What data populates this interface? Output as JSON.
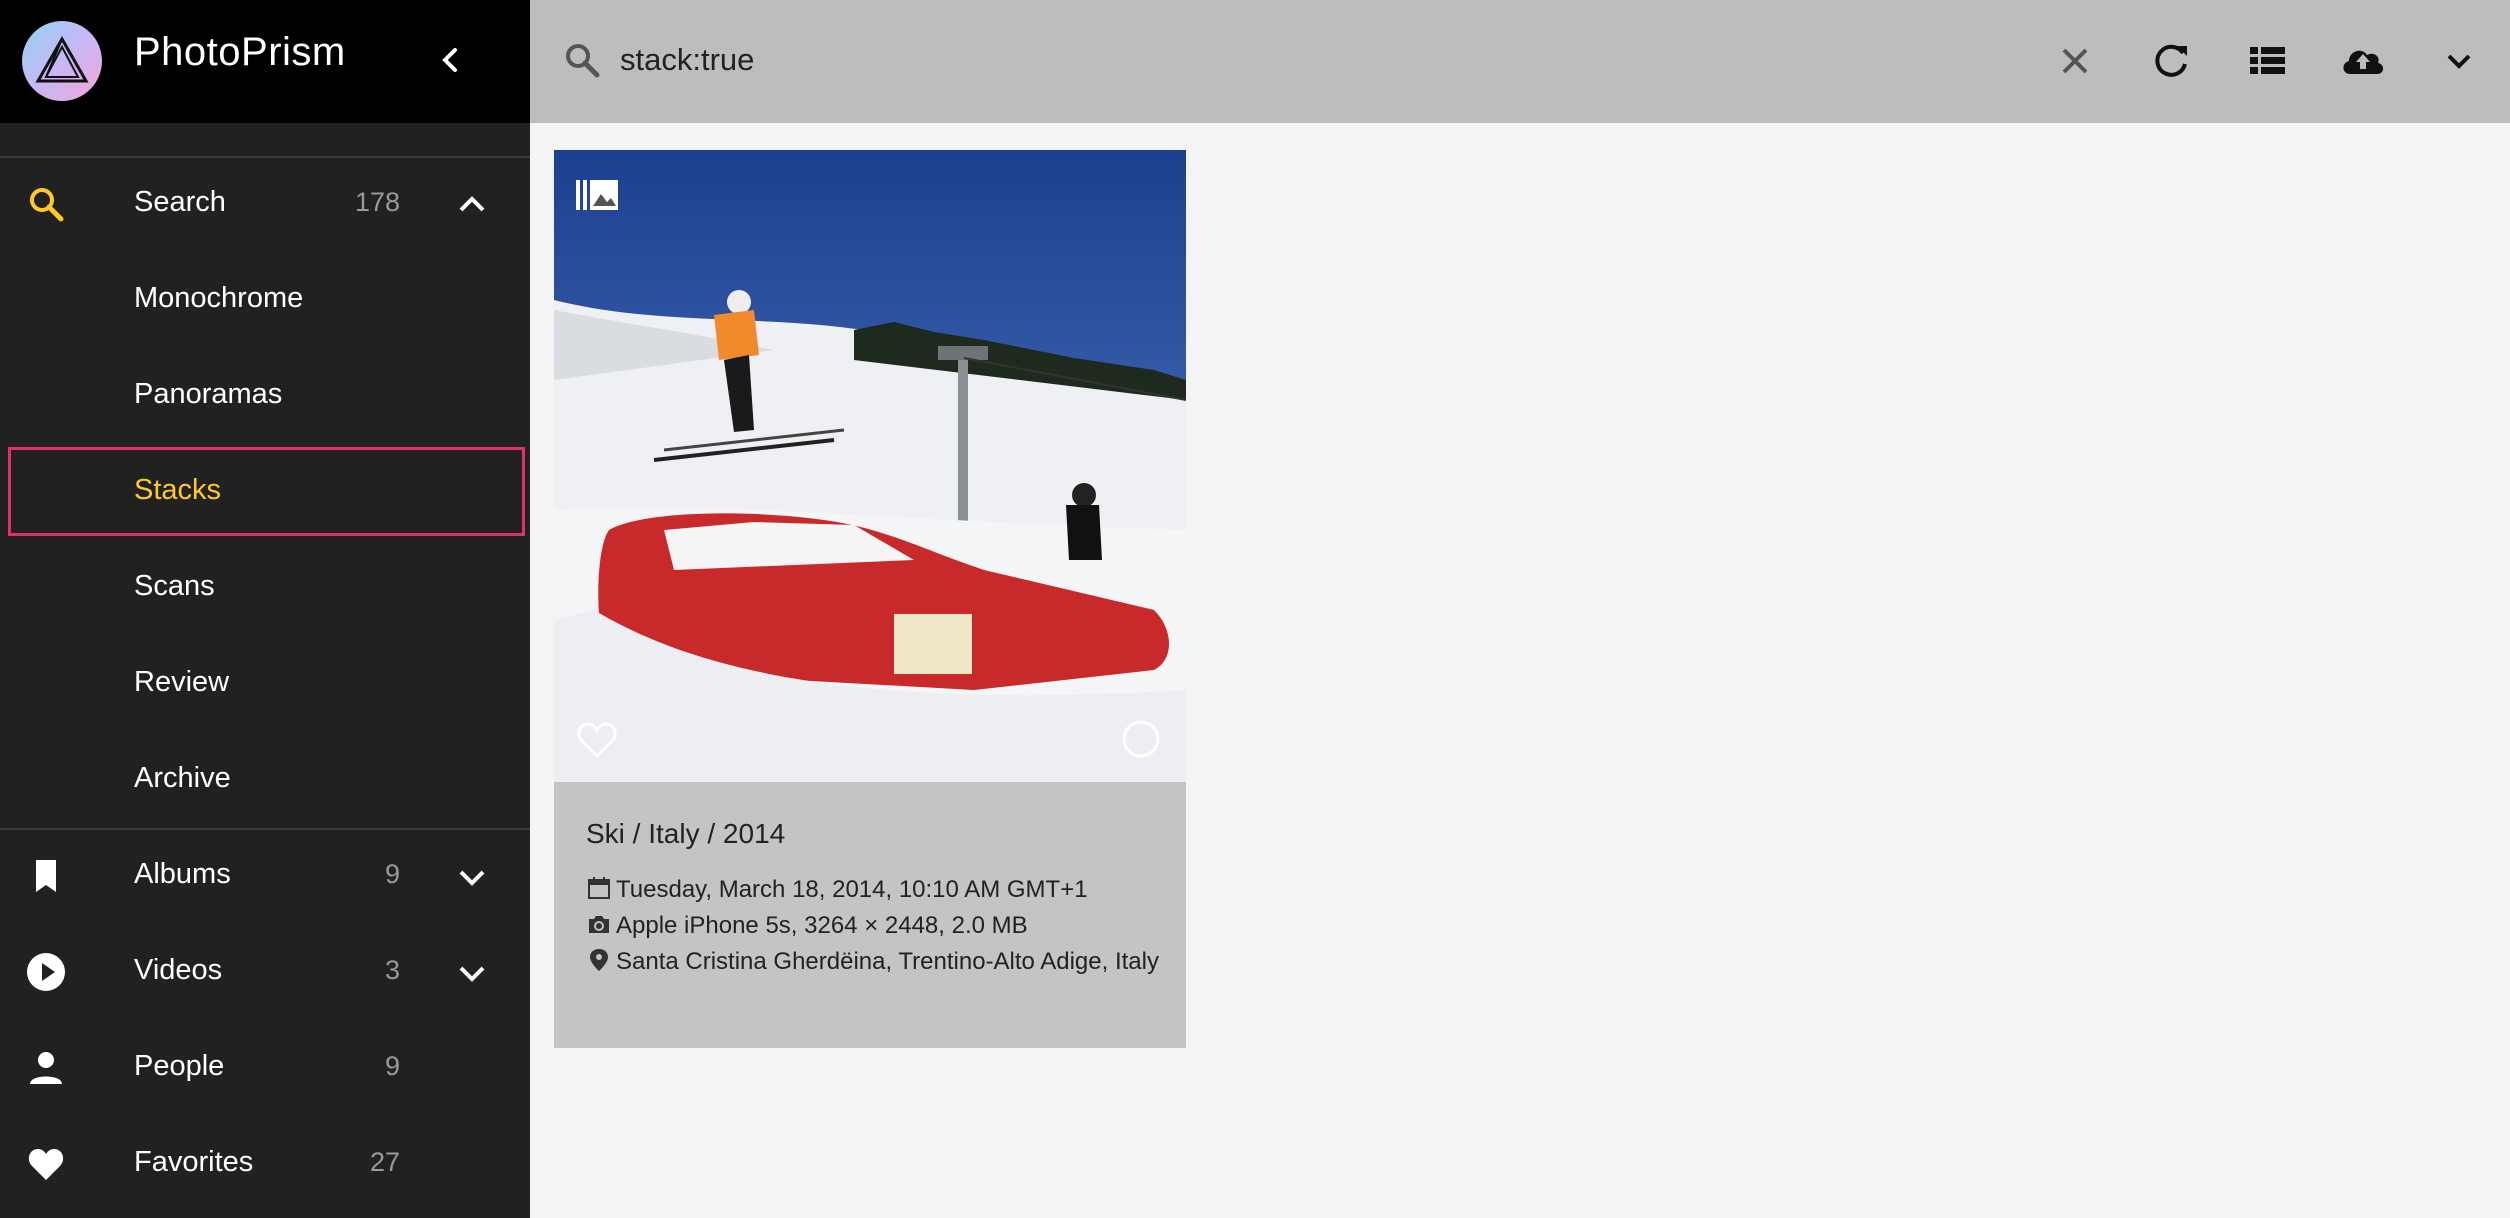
{
  "app": {
    "title": "PhotoPrism"
  },
  "sidebar": {
    "items": [
      {
        "key": "search",
        "label": "Search",
        "count": "178"
      },
      {
        "key": "monochrome",
        "label": "Monochrome"
      },
      {
        "key": "panoramas",
        "label": "Panoramas"
      },
      {
        "key": "stacks",
        "label": "Stacks",
        "active": true
      },
      {
        "key": "scans",
        "label": "Scans"
      },
      {
        "key": "review",
        "label": "Review"
      },
      {
        "key": "archive",
        "label": "Archive"
      },
      {
        "key": "albums",
        "label": "Albums",
        "count": "9"
      },
      {
        "key": "videos",
        "label": "Videos",
        "count": "3"
      },
      {
        "key": "people",
        "label": "People",
        "count": "9"
      },
      {
        "key": "favorites",
        "label": "Favorites",
        "count": "27"
      }
    ]
  },
  "toolbar": {
    "search_value": "stack:true",
    "buttons": [
      "clear-icon",
      "refresh-icon",
      "list-view-icon",
      "upload-icon",
      "expand-icon"
    ]
  },
  "photo": {
    "title": "Ski / Italy / 2014",
    "date": "Tuesday, March 18, 2014, 10:10 AM GMT+1",
    "camera": "Apple iPhone 5s, 3264 × 2448, 2.0 MB",
    "location": "Santa Cristina Gherdëina, Trentino-Alto Adige, Italy"
  },
  "colors": {
    "accent": "#ffca28",
    "highlight": "#e0306a",
    "sidebar_bg": "#212121",
    "toolbar_bg": "#bdbdbd"
  }
}
